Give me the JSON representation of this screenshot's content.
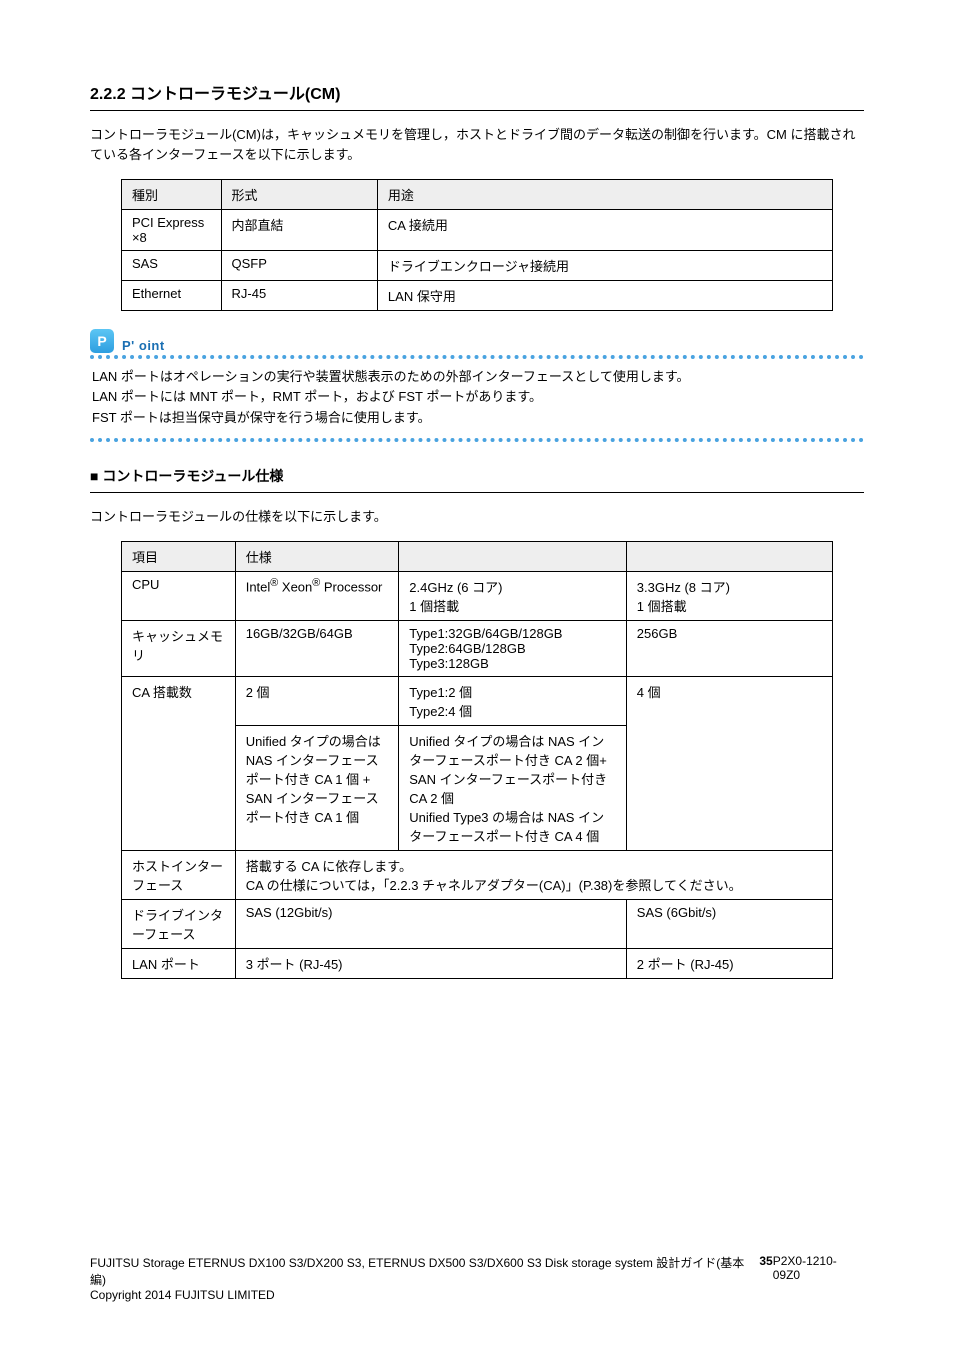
{
  "section1": {
    "title": "2.2.2 コントローラモジュール(CM)",
    "paragraph": "コントローラモジュール(CM)は，キャッシュメモリを管理し，ホストとドライブ間のデータ転送の制御を行います。CM に搭載されている各インターフェースを以下に示します。"
  },
  "table1": {
    "headers": [
      "種別",
      "形式",
      "用途"
    ],
    "rows": [
      [
        "PCI Express ×8",
        "内部直結",
        "CA 接続用"
      ],
      [
        "SAS",
        "QSFP",
        "ドライブエンクロージャ接続用"
      ],
      [
        "Ethernet",
        "RJ-45",
        "LAN 保守用"
      ]
    ]
  },
  "point": {
    "label": "P' oint",
    "body_lines": [
      "LAN ポートはオペレーションの実行や装置状態表示のための外部インターフェースとして使用します。",
      "LAN ポートには MNT ポート，RMT ポート，および FST ポートがあります。",
      "FST ポートは担当保守員が保守を行う場合に使用します。"
    ]
  },
  "section2": {
    "heading": "■ コントローラモジュール仕様",
    "lead": "コントローラモジュールの仕様を以下に示します。"
  },
  "table2": {
    "headers": [
      "項目",
      "仕様",
      "",
      ""
    ],
    "rows": [
      [
        {
          "text": "CPU",
          "rowspan": 1
        },
        {
          "text": "Intel<sup>®</sup> Xeon<sup>®</sup> Processor",
          "rowspan": 1
        },
        {
          "text": "2.4GHz (6 コア)\n1 個搭載",
          "rowspan": 1
        },
        {
          "text": "3.3GHz (8 コア)\n1 個搭載",
          "rowspan": 1
        }
      ],
      [
        {
          "text": "キャッシュメモリ",
          "rowspan": 1
        },
        {
          "text": "16GB/32GB/64GB",
          "rowspan": 1
        },
        {
          "text": "Type1:32GB/64GB/128GB\nType2:64GB/128GB\nType3:128GB",
          "rowspan": 1
        },
        {
          "text": "256GB",
          "rowspan": 1
        }
      ],
      [
        {
          "text": "CA 搭載数",
          "rowspan": 2
        },
        {
          "text": "2 個",
          "rowspan": 1
        },
        {
          "text": "Type1:2 個\nType2:4 個",
          "rowspan": 1
        },
        {
          "text": "4 個",
          "rowspan": 2
        }
      ],
      [
        null,
        {
          "text": "Unified タイプの場合は NAS インターフェースポート付き CA 1 個 + SAN インターフェースポート付き CA 1 個",
          "rowspan": 1
        },
        {
          "text": "Unified タイプの場合は NAS インターフェースポート付き CA 2 個+ SAN インターフェースポート付き CA 2 個\nUnified Type3 の場合は NAS インターフェースポート付き CA 4 個",
          "rowspan": 1
        },
        null
      ],
      [
        {
          "text": "ホストインターフェース",
          "rowspan": 1
        },
        {
          "text": "搭載する CA に依存します。\nCA の仕様については，「2.2.3 チャネルアダプター(CA)」(P.38)を参照してください。",
          "colspan": 3
        }
      ],
      [
        {
          "text": "ドライブインターフェース",
          "rowspan": 1
        },
        {
          "text": "SAS (12Gbit/s)",
          "colspan": 2
        },
        {
          "text": "SAS (6Gbit/s)",
          "rowspan": 1
        }
      ],
      [
        {
          "text": "LAN ポート",
          "rowspan": 1
        },
        {
          "text": "3 ポート (RJ-45)",
          "colspan": 2
        },
        {
          "text": "2 ポート (RJ-45)",
          "rowspan": 1
        }
      ]
    ]
  },
  "footer": {
    "left": "FUJITSU Storage ETERNUS DX100 S3/DX200 S3, ETERNUS DX500 S3/DX600 S3 Disk storage system 設計ガイド(基本編)\nCopyright 2014 FUJITSU LIMITED",
    "center": "35",
    "right": "P2X0-1210-09Z0"
  }
}
